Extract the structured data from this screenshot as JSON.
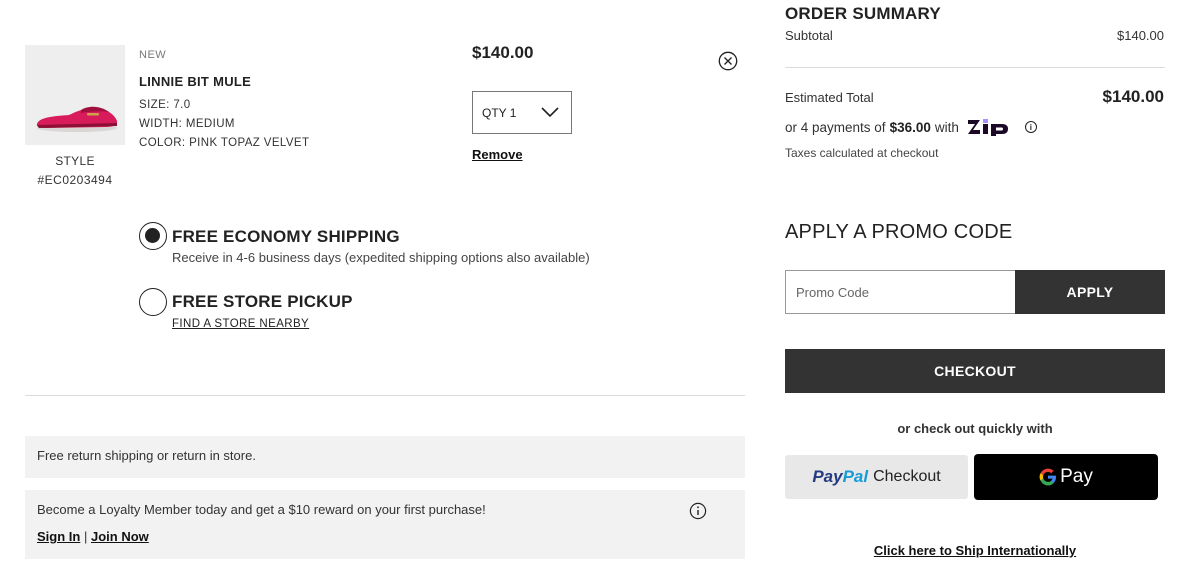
{
  "cart": {
    "item": {
      "badge": "NEW",
      "name": "LINNIE BIT MULE",
      "size": "SIZE: 7.0",
      "width": "WIDTH: MEDIUM",
      "color": "COLOR: PINK TOPAZ VELVET",
      "style_label": "STYLE",
      "style_number": "#EC0203494",
      "price": "$140.00",
      "qty_label": "QTY 1",
      "remove_label": "Remove"
    },
    "shipping": {
      "economy_title": "FREE ECONOMY SHIPPING",
      "economy_sub": "Receive in 4-6 business days (expedited shipping options also available)",
      "economy_selected": true,
      "pickup_title": "FREE STORE PICKUP",
      "pickup_link": "FIND A STORE NEARBY"
    },
    "returns_banner": "Free return shipping or return in store.",
    "loyalty": {
      "text": "Become a Loyalty Member today and get a $10 reward on your first purchase!",
      "sign_in": "Sign In",
      "separator": "|",
      "join_now": "Join Now"
    }
  },
  "summary": {
    "title": "ORDER SUMMARY",
    "subtotal_label": "Subtotal",
    "subtotal_value": "$140.00",
    "estimated_label": "Estimated Total",
    "estimated_value": "$140.00",
    "zip_prefix": "or 4 payments of",
    "zip_amount": "$36.00",
    "zip_suffix": "with",
    "taxes_note": "Taxes calculated at checkout",
    "promo_title": "APPLY A PROMO CODE",
    "promo_placeholder": "Promo Code",
    "apply_label": "APPLY",
    "checkout_label": "CHECKOUT",
    "quick_checkout": "or check out quickly with",
    "paypal_pay": "Pay",
    "paypal_pal": "Pal",
    "paypal_checkout": "Checkout",
    "gpay_label": "Pay",
    "international_link": "Click here to Ship Internationally"
  },
  "colors": {
    "dark_button": "#333333",
    "banner_bg": "#f2f2f2",
    "product_pink": "#d81b5a",
    "zip_purple": "#1a0826"
  }
}
